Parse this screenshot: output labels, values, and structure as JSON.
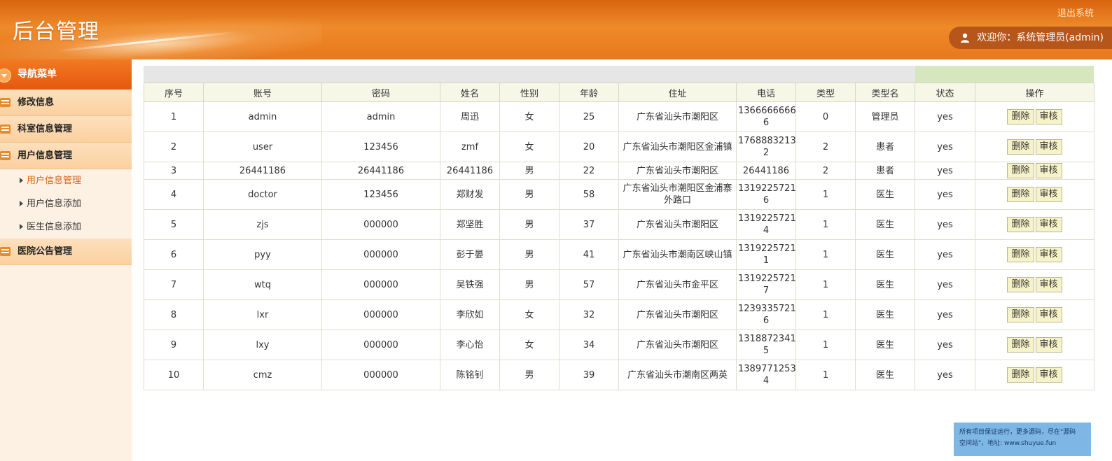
{
  "header": {
    "title": "后台管理",
    "logout": "退出系统",
    "welcome": "欢迎你：系统管理员(admin)"
  },
  "sidebar": {
    "nav_title": "导航菜单",
    "groups": [
      {
        "label": "修改信息",
        "icon": "edit-icon"
      },
      {
        "label": "科室信息管理",
        "icon": "calendar-icon"
      },
      {
        "label": "用户信息管理",
        "icon": "calendar-icon"
      },
      {
        "label": "医院公告管理",
        "icon": "calendar-icon"
      }
    ],
    "sub_items": [
      {
        "label": "用户信息管理",
        "active": true
      },
      {
        "label": "用户信息添加",
        "active": false
      },
      {
        "label": "医生信息添加",
        "active": false
      }
    ]
  },
  "table": {
    "headers": [
      "序号",
      "账号",
      "密码",
      "姓名",
      "性别",
      "年龄",
      "住址",
      "电话",
      "类型",
      "类型名",
      "状态",
      "操作"
    ],
    "delete_label": "删除",
    "review_label": "审核",
    "rows": [
      {
        "no": "1",
        "account": "admin",
        "password": "admin",
        "name": "周迅",
        "gender": "女",
        "age": "25",
        "address": "广东省汕头市潮阳区",
        "phone": "1366666666\n6",
        "type": "0",
        "type_name": "管理员",
        "status": "yes",
        "tall": true
      },
      {
        "no": "2",
        "account": "user",
        "password": "123456",
        "name": "zmf",
        "gender": "女",
        "age": "20",
        "address": "广东省汕头市潮阳区金浦镇",
        "phone": "1768883213\n2",
        "type": "2",
        "type_name": "患者",
        "status": "yes",
        "tall": true
      },
      {
        "no": "3",
        "account": "26441186",
        "password": "26441186",
        "name": "26441186",
        "gender": "男",
        "age": "22",
        "address": "广东省汕头市潮阳区",
        "phone": "26441186",
        "type": "2",
        "type_name": "患者",
        "status": "yes",
        "tall": false
      },
      {
        "no": "4",
        "account": "doctor",
        "password": "123456",
        "name": "郑财发",
        "gender": "男",
        "age": "58",
        "address": "广东省汕头市潮阳区金浦寨\n外路口",
        "phone": "1319225721\n6",
        "type": "1",
        "type_name": "医生",
        "status": "yes",
        "tall": true
      },
      {
        "no": "5",
        "account": "zjs",
        "password": "000000",
        "name": "郑坚胜",
        "gender": "男",
        "age": "37",
        "address": "广东省汕头市潮阳区",
        "phone": "1319225721\n4",
        "type": "1",
        "type_name": "医生",
        "status": "yes",
        "tall": true
      },
      {
        "no": "6",
        "account": "pyy",
        "password": "000000",
        "name": "彭于晏",
        "gender": "男",
        "age": "41",
        "address": "广东省汕头市潮南区峡山镇",
        "phone": "1319225721\n1",
        "type": "1",
        "type_name": "医生",
        "status": "yes",
        "tall": true
      },
      {
        "no": "7",
        "account": "wtq",
        "password": "000000",
        "name": "吴铁强",
        "gender": "男",
        "age": "57",
        "address": "广东省汕头市金平区",
        "phone": "1319225721\n7",
        "type": "1",
        "type_name": "医生",
        "status": "yes",
        "tall": true
      },
      {
        "no": "8",
        "account": "lxr",
        "password": "000000",
        "name": "李欣如",
        "gender": "女",
        "age": "32",
        "address": "广东省汕头市潮阳区",
        "phone": "1239335721\n6",
        "type": "1",
        "type_name": "医生",
        "status": "yes",
        "tall": true
      },
      {
        "no": "9",
        "account": "lxy",
        "password": "000000",
        "name": "李心怡",
        "gender": "女",
        "age": "34",
        "address": "广东省汕头市潮阳区",
        "phone": "1318872341\n5",
        "type": "1",
        "type_name": "医生",
        "status": "yes",
        "tall": true
      },
      {
        "no": "10",
        "account": "cmz",
        "password": "000000",
        "name": "陈铭钊",
        "gender": "男",
        "age": "39",
        "address": "广东省汕头市潮南区两英",
        "phone": "1389771253\n4",
        "type": "1",
        "type_name": "医生",
        "status": "yes",
        "tall": true
      }
    ]
  },
  "watermark": {
    "line1": "所有项目保证运行，更多源码，尽在\"源码",
    "line2": "空间站\"，地址: www.shuyue.fun"
  },
  "colors": {
    "accent": "#e8781c",
    "sidebar_bg": "#fdf1e3",
    "active_link": "#d8641a"
  }
}
